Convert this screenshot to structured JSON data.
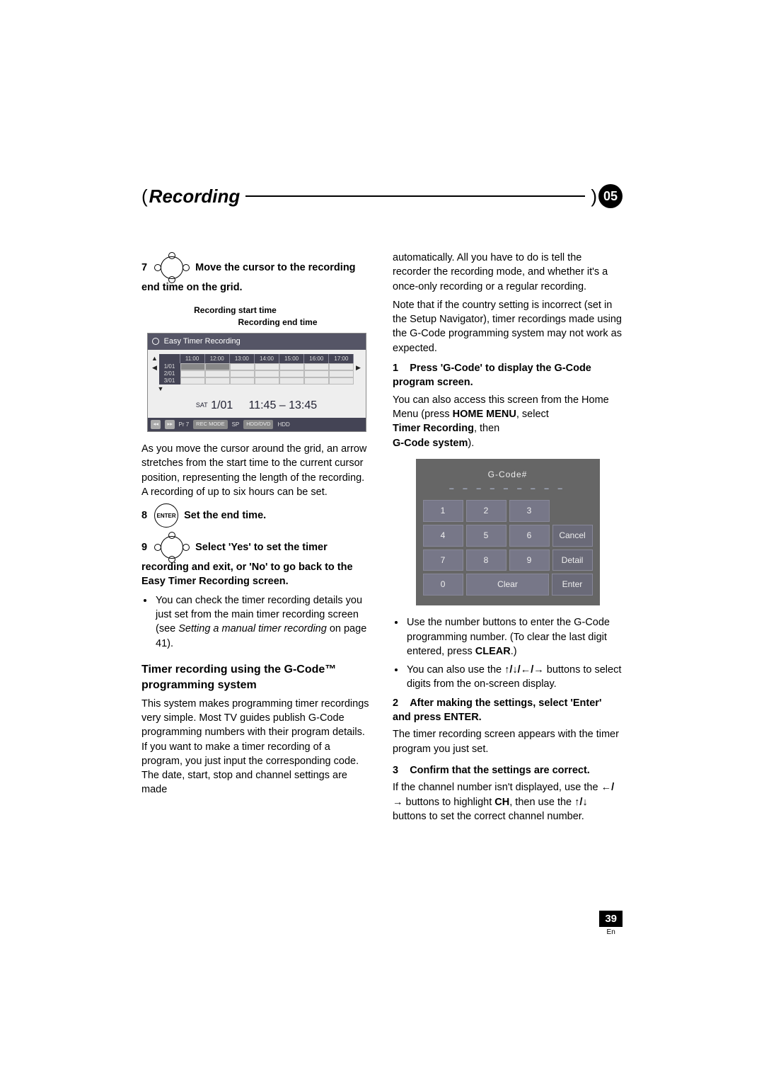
{
  "header": {
    "title": "Recording",
    "chapter": "05"
  },
  "left": {
    "step7_num": "7",
    "step7_text": "Move the cursor to the recording end time on the grid.",
    "label_start": "Recording start time",
    "label_end": "Recording end time",
    "grid": {
      "title": "Easy Timer Recording",
      "times": [
        "11:00",
        "12:00",
        "13:00",
        "14:00",
        "15:00",
        "16:00",
        "17:00"
      ],
      "dates": [
        "1/01",
        "2/01",
        "3/01"
      ],
      "info_day": "SAT",
      "info_date": "1/01",
      "info_range": "11:45  –  13:45",
      "bottom_pr": "Pr 7",
      "bottom_recmode": "REC MODE",
      "bottom_sp": "SP",
      "bottom_hdd_dvd": "HDD/DVD",
      "bottom_hdd": "HDD"
    },
    "para_cursor": "As you move the cursor around the grid, an arrow stretches from the start time to the current cursor position, representing the length of the recording. A recording of up to six hours can be set.",
    "step8_num": "8",
    "enter_label": "ENTER",
    "step8_text": "Set the end time.",
    "step9_num": "9",
    "step9_text": "Select 'Yes' to set the timer recording and exit, or 'No' to go back to the Easy Timer Recording screen.",
    "bullet1a": "You can check the timer recording details you just set from the main timer recording screen (see ",
    "bullet1_italic": "Setting a manual timer recording",
    "bullet1b": " on page 41).",
    "section_heading": "Timer recording using the G-Code™ programming system",
    "para_system": "This system makes programming timer recordings very simple. Most TV guides publish G-Code programming numbers with their program details. If you want to make a timer recording of a program, you just input the corresponding code. The date, start, stop and channel settings are made"
  },
  "right": {
    "para_auto": "automatically. All you have to do is tell the recorder the recording mode, and whether it's a once-only recording or a regular recording.",
    "para_note": "Note that if the country setting is incorrect (set in the Setup Navigator), timer recordings made using the G-Code programming system may not work as expected.",
    "step1_num": "1",
    "step1_text": "Press 'G-Code' to display the G-Code program screen.",
    "para_access_a": "You can also access this screen from the Home Menu (press ",
    "home_menu": "HOME MENU",
    "para_access_b": ", select ",
    "timer_rec": "Timer Recording",
    "para_access_c": ", then",
    "gcode_sys": "G-Code system",
    "para_access_d": ").",
    "keypad": {
      "title": "G-Code#",
      "dashes": "– – – – – – – – –",
      "k1": "1",
      "k2": "2",
      "k3": "3",
      "k4": "4",
      "k5": "5",
      "k6": "6",
      "cancel": "Cancel",
      "k7": "7",
      "k8": "8",
      "k9": "9",
      "detail": "Detail",
      "k0": "0",
      "clear": "Clear",
      "enter": "Enter"
    },
    "bullet_use_a": "Use the number buttons to enter the G-Code programming number. (To clear the last digit entered, press ",
    "clear_bold": "CLEAR",
    "bullet_use_b": ".)",
    "bullet_arrows_a": "You can also use the ",
    "bullet_arrows_b": " buttons to select digits from the on-screen display.",
    "step2_num": "2",
    "step2_text": "After making the settings, select 'Enter' and press ENTER.",
    "para_timer": "The timer recording screen appears with the timer program you just set.",
    "step3_num": "3",
    "step3_text": "Confirm that the settings are correct.",
    "para_confirm_a": "If the channel number isn't displayed, use the ",
    "para_confirm_b": " buttons to highlight ",
    "ch_bold": "CH",
    "para_confirm_c": ", then use the ",
    "para_confirm_d": " buttons to set the correct channel number."
  },
  "footer": {
    "page": "39",
    "lang": "En"
  }
}
